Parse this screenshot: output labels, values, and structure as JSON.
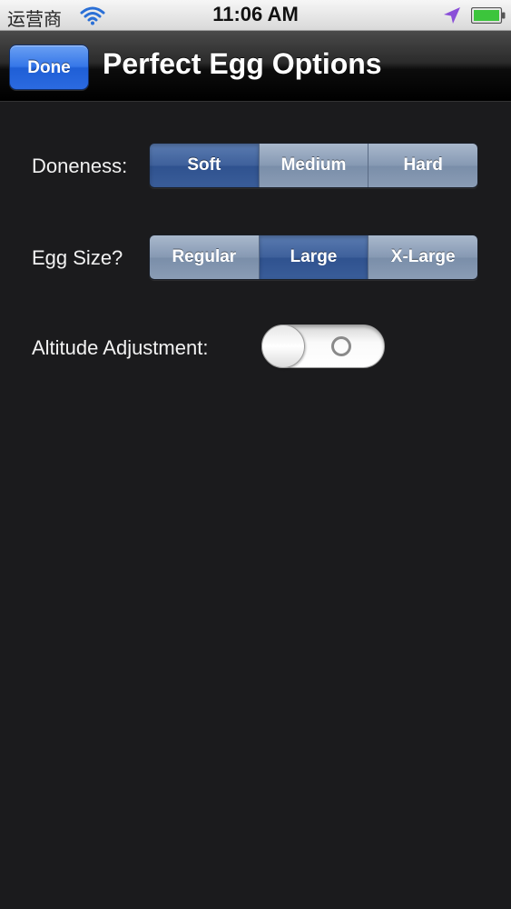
{
  "status_bar": {
    "carrier": "运营商",
    "time": "11:06 AM",
    "icons": [
      "wifi-icon",
      "location-icon",
      "battery-icon"
    ]
  },
  "nav_bar": {
    "done_label": "Done",
    "title": "Perfect Egg Options"
  },
  "doneness": {
    "label": "Doneness:",
    "options": [
      "Soft",
      "Medium",
      "Hard"
    ],
    "selected": "Soft"
  },
  "egg_size": {
    "label": "Egg Size?",
    "options": [
      "Regular",
      "Large",
      "X-Large"
    ],
    "selected": "Large"
  },
  "altitude": {
    "label": "Altitude Adjustment:",
    "state": "off"
  },
  "colors": {
    "background": "#1b1b1d",
    "done_button": "#3677e8",
    "segment_selected": "#3e609b",
    "segment_normal": "#8699b3",
    "battery_green": "#3cc53c",
    "location_purple": "#8a4fd8"
  }
}
